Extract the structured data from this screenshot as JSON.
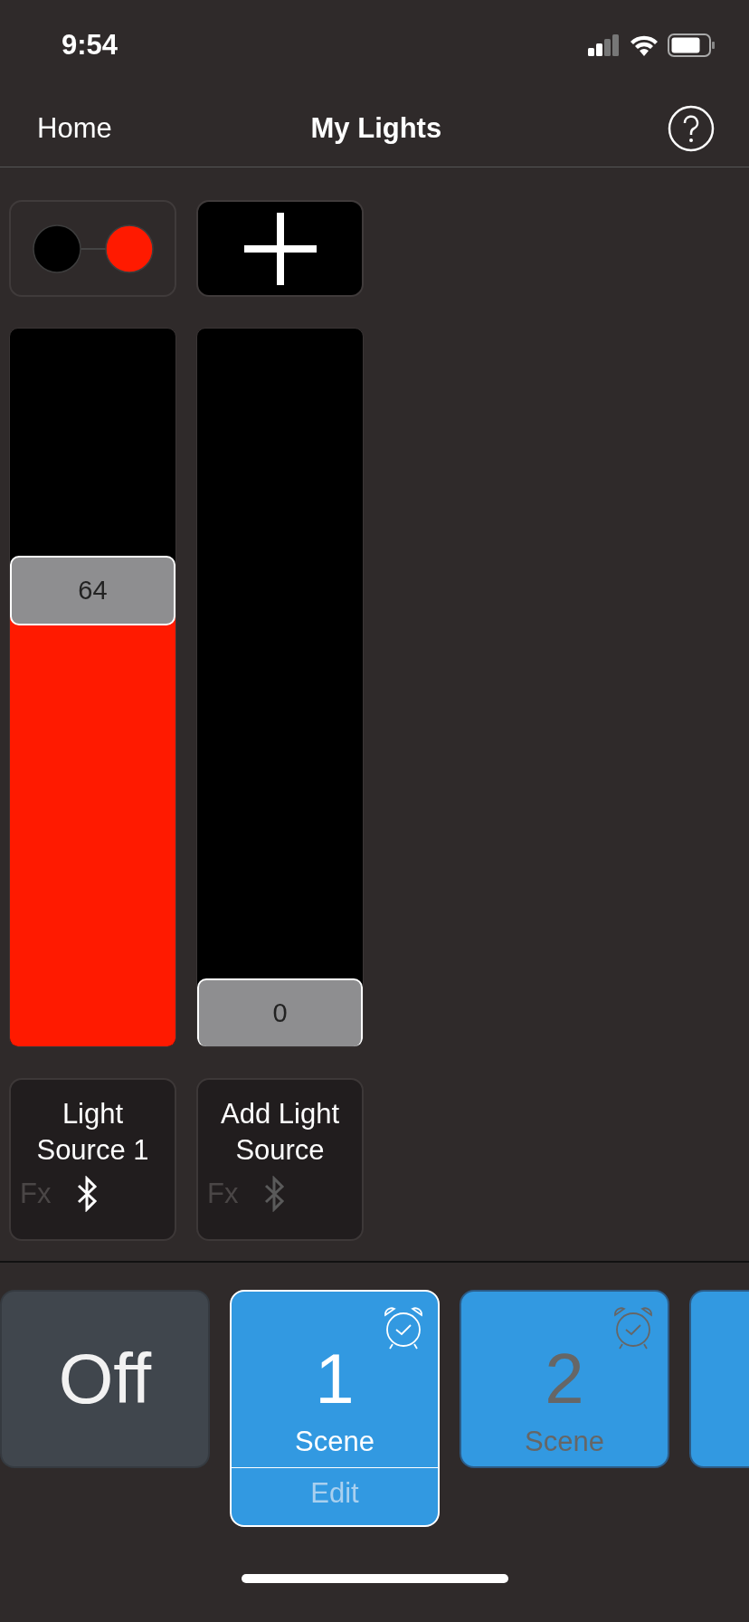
{
  "status_bar": {
    "time": "9:54"
  },
  "nav": {
    "back": "Home",
    "title": "My Lights"
  },
  "color_toggle": {
    "dots": [
      {
        "color": "#000000"
      },
      {
        "color": "#ff1a00"
      }
    ]
  },
  "channels": [
    {
      "name": "Light Source 1",
      "value": "64",
      "level": 0.65,
      "color": "#ff1a00",
      "fx_label": "Fx",
      "fx_on": false,
      "bluetooth_connected": true
    },
    {
      "name": "Add Light Source",
      "value": "0",
      "level": 0,
      "fx_label": "Fx",
      "fx_on": false,
      "bluetooth_connected": false
    }
  ],
  "scenes": [
    {
      "kind": "off",
      "label": "Off",
      "selected": false
    },
    {
      "kind": "scene",
      "number": "1",
      "label": "Scene",
      "alarm": true,
      "selected": true,
      "edit_label": "Edit"
    },
    {
      "kind": "scene",
      "number": "2",
      "label": "Scene",
      "alarm": true,
      "selected": false
    },
    {
      "kind": "partial",
      "selected": false
    }
  ]
}
